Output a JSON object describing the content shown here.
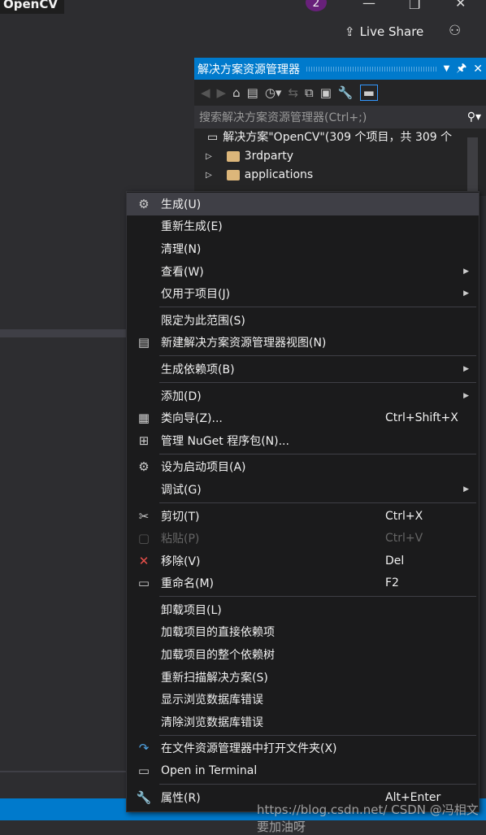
{
  "window": {
    "title": "OpenCV",
    "notification_count": "2",
    "live_share": "Live Share"
  },
  "panel": {
    "title": "解决方案资源管理器",
    "search_placeholder": "搜索解决方案资源管理器(Ctrl+;)",
    "tree": [
      {
        "label": "解决方案\"OpenCV\"(309 个项目，共 309 个",
        "icon": "solution-icon"
      },
      {
        "label": "3rdparty",
        "icon": "folder-icon"
      },
      {
        "label": "applications",
        "icon": "folder-icon"
      }
    ]
  },
  "menu": [
    {
      "label": "生成(U)",
      "icon": "build-icon",
      "glyph": "⚙",
      "highlight": true
    },
    {
      "label": "重新生成(E)"
    },
    {
      "label": "清理(N)"
    },
    {
      "label": "查看(W)",
      "submenu": true
    },
    {
      "label": "仅用于项目(J)",
      "submenu": true
    },
    {
      "sep": true
    },
    {
      "label": "限定为此范围(S)"
    },
    {
      "label": "新建解决方案资源管理器视图(N)",
      "icon": "new-view-icon",
      "glyph": "▤"
    },
    {
      "sep": true
    },
    {
      "label": "生成依赖项(B)",
      "submenu": true
    },
    {
      "sep": true
    },
    {
      "label": "添加(D)",
      "submenu": true
    },
    {
      "label": "类向导(Z)...",
      "shortcut": "Ctrl+Shift+X",
      "icon": "class-wizard-icon",
      "glyph": "▦"
    },
    {
      "label": "管理 NuGet 程序包(N)...",
      "icon": "nuget-icon",
      "glyph": "⊞"
    },
    {
      "sep": true
    },
    {
      "label": "设为启动项目(A)",
      "icon": "gear-icon",
      "glyph": "⚙"
    },
    {
      "label": "调试(G)",
      "submenu": true
    },
    {
      "sep": true
    },
    {
      "label": "剪切(T)",
      "shortcut": "Ctrl+X",
      "icon": "scissors-icon",
      "glyph": "✂"
    },
    {
      "label": "粘贴(P)",
      "shortcut": "Ctrl+V",
      "icon": "paste-icon",
      "glyph": "▢",
      "disabled": true
    },
    {
      "label": "移除(V)",
      "shortcut": "Del",
      "icon": "remove-icon",
      "glyph": "✕",
      "color": "#e8504a"
    },
    {
      "label": "重命名(M)",
      "shortcut": "F2",
      "icon": "rename-icon",
      "glyph": "▭"
    },
    {
      "sep": true
    },
    {
      "label": "卸载项目(L)"
    },
    {
      "label": "加载项目的直接依赖项"
    },
    {
      "label": "加载项目的整个依赖树"
    },
    {
      "label": "重新扫描解决方案(S)"
    },
    {
      "label": "显示浏览数据库错误"
    },
    {
      "label": "清除浏览数据库错误"
    },
    {
      "sep": true
    },
    {
      "label": "在文件资源管理器中打开文件夹(X)",
      "icon": "open-folder-arrow-icon",
      "glyph": "↷",
      "color": "#4fa3e3"
    },
    {
      "label": "Open in Terminal",
      "icon": "terminal-icon",
      "glyph": "▭"
    },
    {
      "sep": true
    },
    {
      "label": "属性(R)",
      "shortcut": "Alt+Enter",
      "icon": "wrench-icon",
      "glyph": "🔧"
    }
  ],
  "watermark": "https://blog.csdn.net/ CSDN @冯相文要加油呀",
  "colors": {
    "accent": "#007acc",
    "menu_bg": "#1b1b1c",
    "bg": "#2d2d30"
  }
}
